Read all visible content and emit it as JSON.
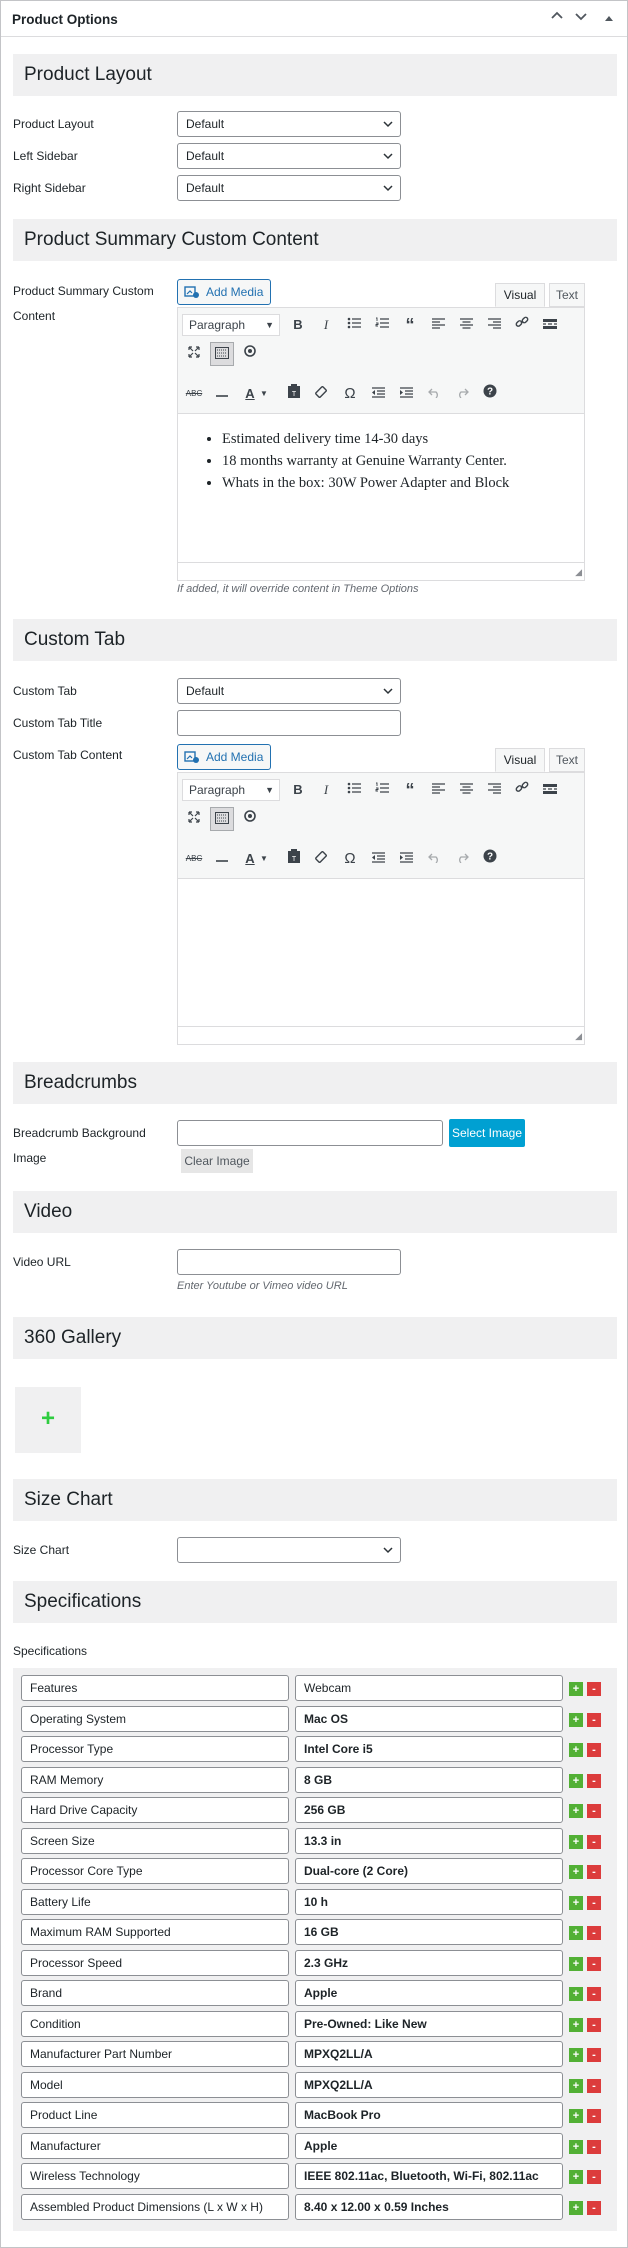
{
  "header": {
    "title": "Product Options",
    "controls": [
      "^",
      "v",
      "▲"
    ]
  },
  "sections": {
    "product_layout": "Product Layout",
    "summary": "Product Summary Custom Content",
    "custom_tab": "Custom Tab",
    "breadcrumbs": "Breadcrumbs",
    "video": "Video",
    "gallery": "360 Gallery",
    "size_chart": "Size Chart",
    "specifications": "Specifications"
  },
  "layout_fields": {
    "product_layout": {
      "label": "Product Layout",
      "value": "Default"
    },
    "left_sidebar": {
      "label": "Left Sidebar",
      "value": "Default"
    },
    "right_sidebar": {
      "label": "Right Sidebar",
      "value": "Default"
    }
  },
  "summary": {
    "label_line1": "Product Summary Custom",
    "label_line2": "Content",
    "add_media": "Add Media",
    "tab_visual": "Visual",
    "tab_text": "Text",
    "format": "Paragraph",
    "bullets": [
      "Estimated delivery time 14-30 days",
      "18 months warranty at Genuine Warranty Center.",
      "Whats in the box: 30W Power Adapter and Block"
    ],
    "hint": "If added, it will override content in Theme Options"
  },
  "custom_tab": {
    "tab_label": "Custom Tab",
    "tab_value": "Default",
    "title_label": "Custom Tab Title",
    "title_value": "",
    "content_label": "Custom Tab Content",
    "add_media": "Add Media",
    "tab_visual": "Visual",
    "tab_text": "Text",
    "format": "Paragraph"
  },
  "breadcrumbs": {
    "label_line1": "Breadcrumb Background",
    "label_line2": "Image",
    "value": "",
    "select_button": "Select Image",
    "clear_button": "Clear Image"
  },
  "video": {
    "label": "Video URL",
    "value": "",
    "hint": "Enter Youtube or Vimeo video URL"
  },
  "gallery": {
    "add_label": "+"
  },
  "size_chart": {
    "label": "Size Chart",
    "value": ""
  },
  "specifications": {
    "label": "Specifications",
    "plus": "+",
    "minus": "-",
    "rows": [
      {
        "key": "Features",
        "value": "Webcam",
        "bold": false
      },
      {
        "key": "Operating System",
        "value": "Mac OS",
        "bold": true
      },
      {
        "key": "Processor Type",
        "value": "Intel Core i5",
        "bold": true
      },
      {
        "key": "RAM Memory",
        "value": " 8 GB",
        "bold": true
      },
      {
        "key": "Hard Drive Capacity",
        "value": "256 GB",
        "bold": true
      },
      {
        "key": "Screen Size",
        "value": "13.3 in",
        "bold": true
      },
      {
        "key": "Processor Core Type",
        "value": "Dual-core (2 Core)",
        "bold": true
      },
      {
        "key": "Battery Life",
        "value": "10 h",
        "bold": true
      },
      {
        "key": "Maximum RAM Supported",
        "value": "16 GB",
        "bold": true
      },
      {
        "key": "Processor Speed",
        "value": "2.3 GHz",
        "bold": true
      },
      {
        "key": "Brand",
        "value": "Apple",
        "bold": true
      },
      {
        "key": "Condition",
        "value": "Pre-Owned: Like New",
        "bold": true
      },
      {
        "key": "Manufacturer Part Number",
        "value": "MPXQ2LL/A",
        "bold": true
      },
      {
        "key": "Model",
        "value": "MPXQ2LL/A",
        "bold": true
      },
      {
        "key": "Product Line",
        "value": "MacBook Pro",
        "bold": true
      },
      {
        "key": "Manufacturer",
        "value": "Apple",
        "bold": true
      },
      {
        "key": "Wireless Technology",
        "value": "IEEE 802.11ac, Bluetooth, Wi-Fi, 802.11ac",
        "bold": true
      },
      {
        "key": "Assembled Product Dimensions (L x W x H)",
        "value": "8.40 x 12.00 x 0.59 Inches",
        "bold": true
      }
    ]
  },
  "colors": {
    "primary": "#2271b1",
    "select_image": "#00a0d2",
    "plus": "#52b035",
    "minus": "#dc3c3c",
    "gallery_plus": "#2ecc40"
  }
}
